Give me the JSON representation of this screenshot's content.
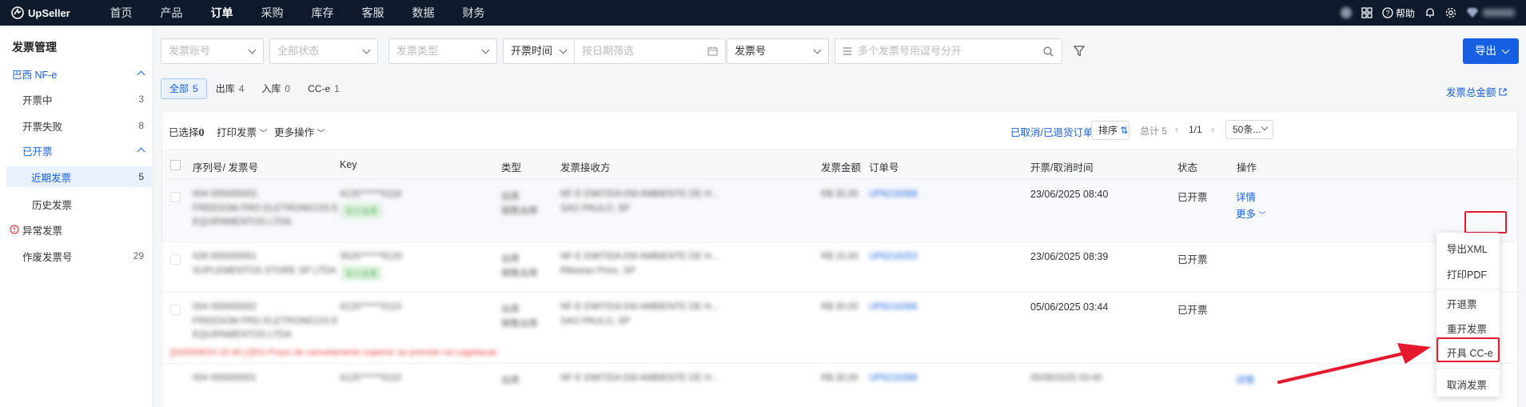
{
  "topnav": {
    "brand": "UpSeller",
    "items": [
      "首页",
      "产品",
      "订单",
      "采购",
      "库存",
      "客服",
      "数据",
      "财务"
    ],
    "active_index": 2,
    "help_label": "帮助"
  },
  "sidebar": {
    "title": "发票管理",
    "group": "巴西 NF-e",
    "items": [
      {
        "label": "开票中",
        "count": "3"
      },
      {
        "label": "开票失败",
        "count": "8"
      },
      {
        "label": "已开票",
        "count": ""
      },
      {
        "label": "近期发票",
        "count": "5"
      },
      {
        "label": "历史发票",
        "count": ""
      },
      {
        "label": "异常发票",
        "count": ""
      },
      {
        "label": "作废发票号",
        "count": "29"
      }
    ]
  },
  "filters": {
    "account_placeholder": "发票账号",
    "status_placeholder": "全部状态",
    "type_placeholder": "发票类型",
    "time_type": "开票时间",
    "date_placeholder": "按日期筛选",
    "number_type": "发票号",
    "number_placeholder": "多个发票号用逗号分开"
  },
  "export_label": "导出",
  "tabs": [
    {
      "label": "全部",
      "count": "5"
    },
    {
      "label": "出库",
      "count": "4"
    },
    {
      "label": "入库",
      "count": "0"
    },
    {
      "label": "CC-e",
      "count": "1"
    }
  ],
  "total_amount_link": "发票总金额",
  "toolbar": {
    "selected_label": "已选择",
    "selected_count": "0",
    "print_label": "打印发票",
    "more_label": "更多操作",
    "cancelled_link": "已取消/已退货订单",
    "sort_label": "排序",
    "total_label": "总计 5",
    "page_label": "1/1",
    "page_size": "50条..."
  },
  "columns": [
    "序列号/ 发票号",
    "Key",
    "类型",
    "发票接收方",
    "发票金额",
    "订单号",
    "开票/取消时间",
    "状态",
    "操作"
  ],
  "rows": [
    {
      "serial": "004 000000003",
      "company1": "FREEDOM PRO ELETRONICOS E",
      "company2": "EQUIPAMENTOS LTDA",
      "key": "4125******0118",
      "tag": "官方发票",
      "type1": "出库",
      "type2": "销售出库",
      "recv1": "NF-E EMITIDA EM AMBIENTE DE H...",
      "recv2": "SAO PAULO, SP",
      "amount": "R$ 35,00",
      "order": "UP6216366",
      "time": "23/06/2025 08:40",
      "status": "已开票",
      "op1": "详情",
      "op2": "更多"
    },
    {
      "serial": "028 000000051",
      "company1": "SUPLEMENTOS STORE SP LTDA",
      "company2": "",
      "key": "3525******9120",
      "tag": "官方发票",
      "type1": "出库",
      "type2": "销售出库",
      "recv1": "NF-E EMITIDA EM AMBIENTE DE H...",
      "recv2": "Ribeirao Pires, SP",
      "amount": "R$ 15,00",
      "order": "UP6216253",
      "time": "23/06/2025 08:39",
      "status": "已开票",
      "op1": "",
      "op2": ""
    },
    {
      "serial": "004 000000002",
      "company1": "FREEDOM PRO ELETRONICOS E",
      "company2": "EQUIPAMENTOS LTDA",
      "key": "4125******0110",
      "tag": "",
      "type1": "出库",
      "type2": "销售出库",
      "recv1": "NF-E EMITIDA EM AMBIENTE DE H...",
      "recv2": "SAO PAULO, SP",
      "amount": "R$ 30,00",
      "order": "UP6216366",
      "time": "05/06/2025 03:44",
      "status": "已开票",
      "op1": "",
      "op2": "",
      "error": "[2025/06/24 22:46 ] [501-Prazo de cancelamento superior ao previsto na Legislacao"
    },
    {
      "serial": "004 000000001",
      "company1": "",
      "company2": "",
      "key": "4125******0110",
      "tag": "",
      "type1": "出库",
      "type2": "",
      "recv1": "NF-E EMITIDA EM AMBIENTE DE H...",
      "recv2": "",
      "amount": "R$ 30,00",
      "order": "UP6216366",
      "time": "05/06/2025 03:40",
      "status": "",
      "op1": "详情",
      "op2": ""
    }
  ],
  "dropdown_menu": [
    "导出XML",
    "打印PDF",
    "开退票",
    "重开发票",
    "开具 CC-e",
    "取消发票"
  ],
  "colors": {
    "primary": "#1560e0",
    "nav_bg": "#0e1a2b",
    "highlight": "#e5192e"
  }
}
